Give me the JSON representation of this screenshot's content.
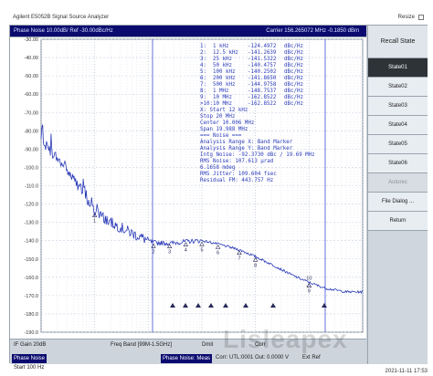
{
  "window": {
    "title": "Agilent E5052B Signal Source Analyzer",
    "resize_label": "Resize"
  },
  "scope": {
    "title_left": "Phase Noise 10.00dB/ Ref -30.00dBc/Hz",
    "title_right": "Carrier 156.265072 MHz     -0.1850 dBm"
  },
  "y_axis": {
    "ticks": [
      "-30.00",
      "-40.00",
      "-50.00",
      "-60.00",
      "-70.00",
      "-80.00",
      "-90.00",
      "-100.0",
      "-110.0",
      "-120.0",
      "-130.0",
      "-140.0",
      "-150.0",
      "-160.0",
      "-170.0",
      "-180.0",
      "-190.0"
    ]
  },
  "marker_table": [
    {
      "n": "1:",
      "f": "1 kHz",
      "v": "-124.4972",
      "u": "dBc/Hz"
    },
    {
      "n": "2:",
      "f": "12.5 kHz",
      "v": "-141.2639",
      "u": "dBc/Hz"
    },
    {
      "n": "3:",
      "f": "25 kHz",
      "v": "-141.5322",
      "u": "dBc/Hz"
    },
    {
      "n": "4:",
      "f": "50 kHz",
      "v": "-140.4757",
      "u": "dBc/Hz"
    },
    {
      "n": "5:",
      "f": "100 kHz",
      "v": "-140.2502",
      "u": "dBc/Hz"
    },
    {
      "n": "6:",
      "f": "200 kHz",
      "v": "-141.8650",
      "u": "dBc/Hz"
    },
    {
      "n": "7:",
      "f": "500 kHz",
      "v": "-144.9758",
      "u": "dBc/Hz"
    },
    {
      "n": "8:",
      "f": "1 MHz",
      "v": "-148.7537",
      "u": "dBc/Hz"
    },
    {
      "n": "9:",
      "f": "10 MHz",
      "v": "-162.8522",
      "u": "dBc/Hz"
    },
    {
      "n": ">10:",
      "f": "10 MHz",
      "v": "-162.8522",
      "u": "dBc/Hz"
    }
  ],
  "info_lines": [
    "X: Start 12 kHz",
    "   Stop 20 MHz",
    "   Center 10.006 MHz",
    "   Span 19.988 MHz",
    "=== Noise ===",
    "Analysis Range X: Band Marker",
    "Analysis Range Y: Band Marker",
    "Intg Noise: -92.3730 dBc / 19.69 MHz",
    "RMS Noise: 107.613 µrad",
    "            6.1658 mdeg",
    "RMS Jitter: 109.604 fsec",
    "Residual FM: 443.757 Hz"
  ],
  "right_panel": {
    "title": "Recall State",
    "buttons": [
      "State01",
      "State02",
      "State03",
      "State04",
      "State05",
      "State06",
      "Autorec",
      "File Dialog ...",
      "Return"
    ]
  },
  "bottom": {
    "row1": [
      "IF Gain 20dB",
      "Freq Band [99M-1.5GHz]",
      "Dmit",
      "Corr"
    ],
    "row2_tag1": "Phase Noise",
    "row2_start": "Start 100 Hz",
    "row2_tag2": "Phase Noise: Meas",
    "row2_corr": "Corr: UTL:0001  Out: 0.0000 V",
    "row2_ext": "Ext Ref",
    "timestamp": "2021-11-11 17:53"
  },
  "watermark": "Lisleapex",
  "chart_data": {
    "type": "line",
    "x_scale": "log",
    "xlim": [
      "100 Hz",
      "100 MHz"
    ],
    "ylim": [
      -190,
      -30
    ],
    "ylabel": "dBc/Hz",
    "series": [
      {
        "x": [
          "100 Hz",
          "200 Hz",
          "500 Hz",
          "1 kHz",
          "2 kHz",
          "5 kHz",
          "10 kHz",
          "12.5 kHz",
          "25 kHz",
          "50 kHz",
          "100 kHz",
          "200 kHz",
          "500 kHz",
          "1 MHz",
          "2 MHz",
          "5 MHz",
          "10 MHz",
          "20 MHz",
          "50 MHz",
          "100 MHz"
        ],
        "y": [
          -85,
          -95,
          -110,
          -124,
          -130,
          -136,
          -140,
          -141,
          -141.5,
          -140.5,
          -140,
          -141.8,
          -145,
          -148.7,
          -153,
          -159,
          -162.8,
          -166,
          -168,
          -168
        ]
      }
    ],
    "markers": [
      {
        "label": "1",
        "x": "1 kHz",
        "y": -124.5
      },
      {
        "label": "2",
        "x": "12.5 kHz",
        "y": -141.3
      },
      {
        "label": "3",
        "x": "25 kHz",
        "y": -141.5
      },
      {
        "label": "4",
        "x": "50 kHz",
        "y": -140.5
      },
      {
        "label": "5",
        "x": "100 kHz",
        "y": -140.3
      },
      {
        "label": "6",
        "x": "200 kHz",
        "y": -141.9
      },
      {
        "label": "7",
        "x": "500 kHz",
        "y": -145.0
      },
      {
        "label": "8",
        "x": "1 MHz",
        "y": -148.8
      },
      {
        "label": "9",
        "x": "10 MHz",
        "y": -162.9
      },
      {
        "label": "10",
        "x": "10 MHz",
        "y": -162.9
      }
    ],
    "band_markers": [
      "12 kHz",
      "20 MHz"
    ]
  }
}
